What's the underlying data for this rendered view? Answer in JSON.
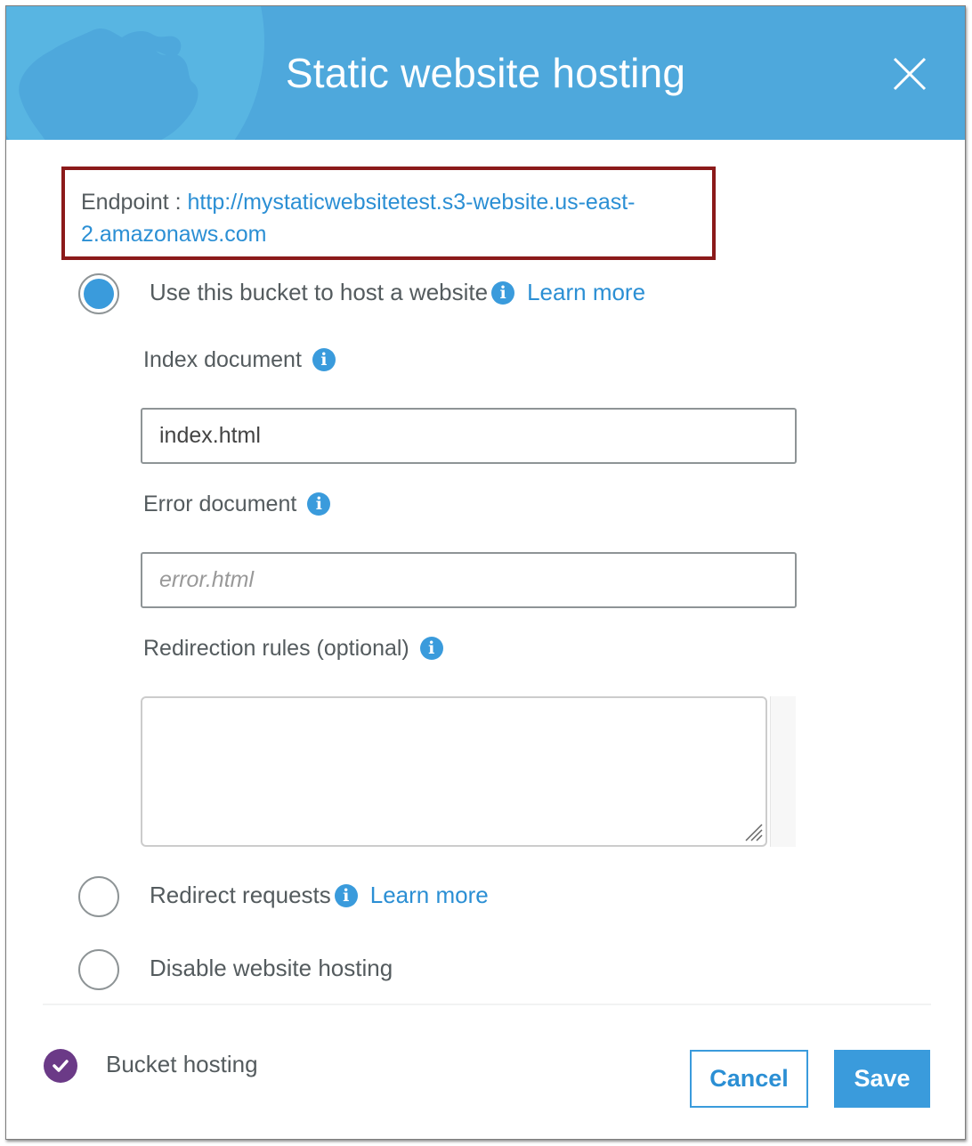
{
  "dialog": {
    "title": "Static website hosting",
    "close_icon": "close-icon",
    "header_bg_color": "#4ea8dc"
  },
  "endpoint": {
    "label": "Endpoint : ",
    "url": "http://mystaticwebsitetest.s3-website.us-east-2.amazonaws.com",
    "highlight_color": "#8b1a1a"
  },
  "options": [
    {
      "label": "Use this bucket to host a website",
      "selected": true,
      "info_icon": "info-icon",
      "learn_more": "Learn more"
    },
    {
      "label": "Redirect requests",
      "selected": false,
      "info_icon": "info-icon",
      "learn_more": "Learn more"
    },
    {
      "label": "Disable website hosting",
      "selected": false
    }
  ],
  "fields": {
    "index_document": {
      "label": "Index document",
      "value": "index.html",
      "placeholder": ""
    },
    "error_document": {
      "label": "Error document",
      "value": "",
      "placeholder": "error.html"
    },
    "redirection_rules": {
      "label": "Redirection rules (optional)",
      "value": ""
    }
  },
  "footer": {
    "status_icon": "check-circle-icon",
    "status_text": "Bucket hosting",
    "status_color": "#6b3a87",
    "cancel_label": "Cancel",
    "save_label": "Save"
  },
  "info_glyph": "i",
  "accent_color": "#3a9bdc"
}
